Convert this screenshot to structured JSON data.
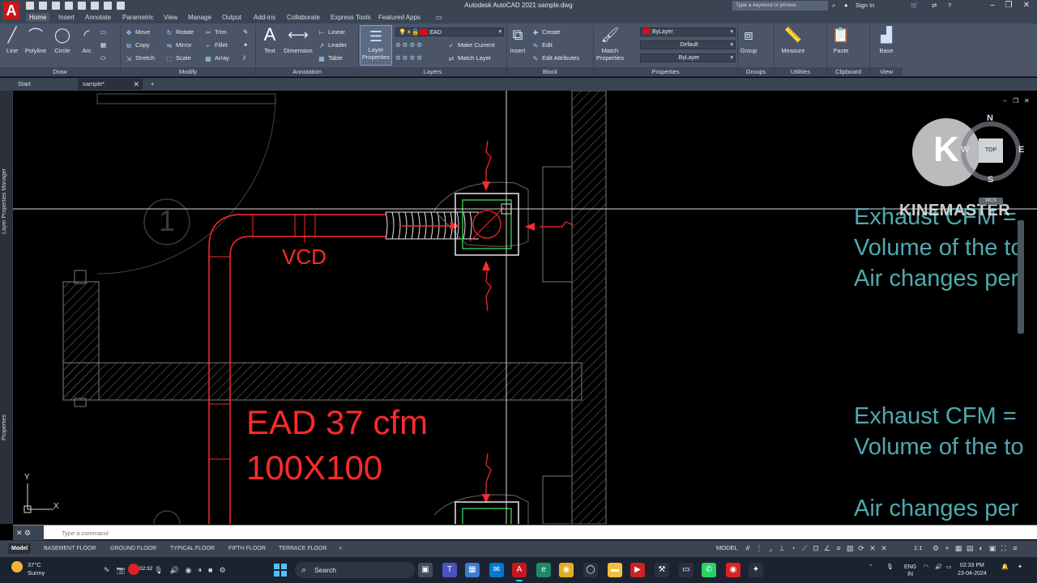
{
  "app": {
    "logo_letter": "A",
    "title": "Autodesk AutoCAD 2021   sample.dwg",
    "search_placeholder": "Type a keyword or phrase",
    "sign_in": "Sign In"
  },
  "ribbon_tabs": [
    "Home",
    "Insert",
    "Annotate",
    "Parametric",
    "View",
    "Manage",
    "Output",
    "Add-ins",
    "Collaborate",
    "Express Tools",
    "Featured Apps"
  ],
  "ribbon": {
    "draw": {
      "label": "Draw",
      "line": "Line",
      "polyline": "Polyline",
      "circle": "Circle",
      "arc": "Arc"
    },
    "modify": {
      "label": "Modify",
      "move": "Move",
      "rotate": "Rotate",
      "trim": "Trim",
      "copy": "Copy",
      "mirror": "Mirror",
      "fillet": "Fillet",
      "stretch": "Stretch",
      "scale": "Scale",
      "array": "Array"
    },
    "annotation": {
      "label": "Annotation",
      "text": "Text",
      "dimension": "Dimension",
      "linear": "Linear",
      "leader": "Leader",
      "table": "Table"
    },
    "layers": {
      "label": "Layers",
      "layer_properties": "Layer Properties",
      "current_layer": "EAD",
      "make_current": "Make Current",
      "match_layer": "Match Layer",
      "layer_color": "#ff0000"
    },
    "block": {
      "label": "Block",
      "insert": "Insert",
      "create": "Create",
      "edit": "Edit",
      "edit_attributes": "Edit Attributes"
    },
    "properties": {
      "label": "Properties",
      "match_properties": "Match Properties",
      "color": "ByLayer",
      "linetype": "Default",
      "lineweight": "ByLayer"
    },
    "groups": {
      "label": "Groups",
      "group": "Group"
    },
    "utilities": {
      "label": "Utilities",
      "measure": "Measure"
    },
    "clipboard": {
      "label": "Clipboard",
      "paste": "Paste"
    },
    "view": {
      "label": "View",
      "base": "Base"
    }
  },
  "file_tabs": {
    "start": "Start",
    "sample": "sample*"
  },
  "side_palettes": {
    "layer_manager": "Layer Properties Manager",
    "properties": "Properties"
  },
  "drawing": {
    "colors": {
      "duct": "#ff2a2a",
      "linework": "#8a8a8a",
      "notes": "#4ea9b0",
      "hatch": "#6d6d6d"
    },
    "grid_bubble": "1",
    "vcd_label": "VCD",
    "ead_label": "EAD 37 cfm",
    "size_label": "100X100",
    "notes_1": [
      "Exhaust CFM =",
      "Volume of the to",
      "Air changes per"
    ],
    "notes_2": [
      "Exhaust CFM =",
      "Volume of the to",
      "Air changes per"
    ],
    "ucs_y": "Y",
    "ucs_x": "X"
  },
  "viewcube": {
    "top": "TOP",
    "n": "N",
    "s": "S",
    "e": "E",
    "w": "W",
    "wcs": "WCS"
  },
  "watermark": {
    "brand": "KINEMASTER",
    "letter": "K"
  },
  "command": {
    "placeholder": "Type a command"
  },
  "layout_tabs": [
    "Model",
    "BASEMENT FLOOR",
    "GROUND FLOOR",
    "TYPICAL FLOOR",
    "FIFTH FLOOR",
    "TERRACE FLOOR"
  ],
  "status": {
    "model": "MODEL",
    "scale": "1:1"
  },
  "taskbar": {
    "temperature": "37°C",
    "condition": "Sunny",
    "rec_time": "02:32",
    "search": "Search",
    "lang": "ENG",
    "region": "IN",
    "time": "02:33 PM",
    "date": "23-04-2024"
  }
}
